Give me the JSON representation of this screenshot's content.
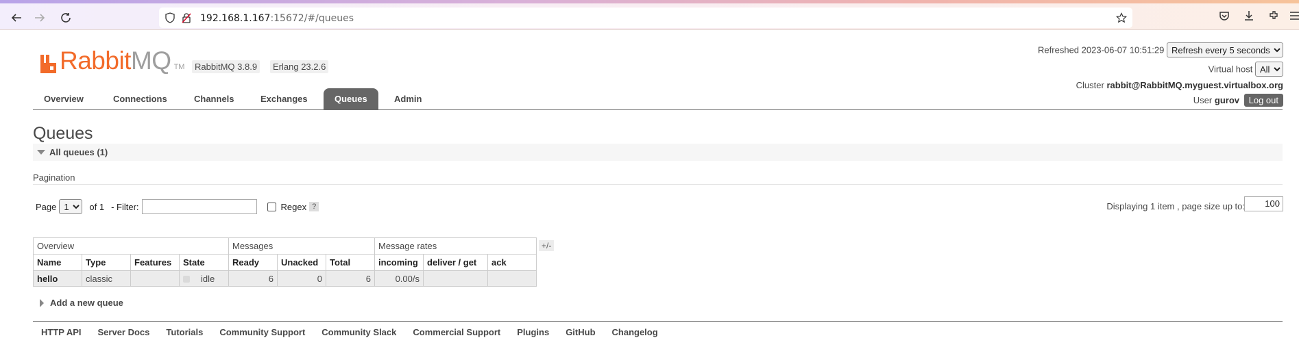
{
  "browser": {
    "url_host": "192.168.1.167",
    "url_rest": ":15672/#/queues"
  },
  "header": {
    "logo_rabbit": "Rabbit",
    "logo_mq": "MQ",
    "logo_tm": "TM",
    "rabbitmq_version": "RabbitMQ 3.8.9",
    "erlang_version": "Erlang 23.2.6",
    "refreshed_label": "Refreshed",
    "refreshed_time": "2023-06-07 10:51:29",
    "refresh_select": "Refresh every 5 seconds",
    "vhost_label": "Virtual host",
    "vhost_select": "All",
    "cluster_label": "Cluster",
    "cluster_name": "rabbit@RabbitMQ.myguest.virtualbox.org",
    "user_label": "User",
    "user_name": "gurov",
    "logout_label": "Log out"
  },
  "tabs": [
    {
      "label": "Overview"
    },
    {
      "label": "Connections"
    },
    {
      "label": "Channels"
    },
    {
      "label": "Exchanges"
    },
    {
      "label": "Queues",
      "active": true
    },
    {
      "label": "Admin"
    }
  ],
  "page": {
    "title": "Queues",
    "section_title": "All queues (1)",
    "pagination_label": "Pagination",
    "page_label": "Page",
    "page_select": "1",
    "of_label": "of 1",
    "filter_label": "- Filter:",
    "filter_value": "",
    "regex_label": "Regex",
    "help_label": "?",
    "displaying": "Displaying 1 item , page size up to:",
    "page_size": "100"
  },
  "table": {
    "groups": [
      "Overview",
      "Messages",
      "Message rates"
    ],
    "columns": [
      "Name",
      "Type",
      "Features",
      "State",
      "Ready",
      "Unacked",
      "Total",
      "incoming",
      "deliver / get",
      "ack"
    ],
    "rows": [
      {
        "name": "hello",
        "type": "classic",
        "features": "",
        "state": "idle",
        "ready": "6",
        "unacked": "0",
        "total": "6",
        "incoming": "0.00/s",
        "deliver_get": "",
        "ack": ""
      }
    ],
    "plus_minus": "+/-"
  },
  "add_queue_label": "Add a new queue",
  "footer": [
    "HTTP API",
    "Server Docs",
    "Tutorials",
    "Community Support",
    "Community Slack",
    "Commercial Support",
    "Plugins",
    "GitHub",
    "Changelog"
  ],
  "colors": {
    "brand_orange": "#f26b2a",
    "tab_active": "#666666",
    "text": "#484848"
  }
}
